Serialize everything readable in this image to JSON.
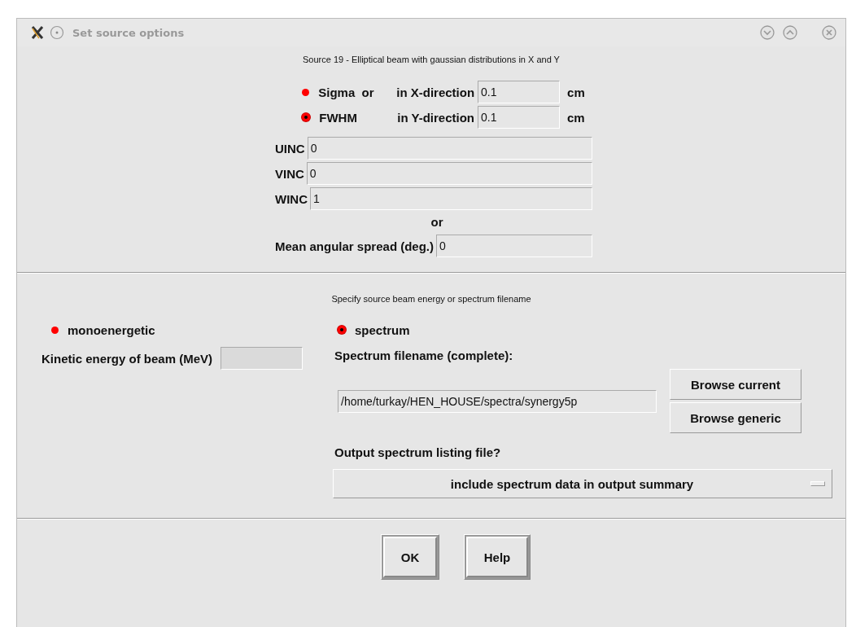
{
  "window": {
    "title": "Set source options"
  },
  "source_title": "Source 19 - Elliptical beam with gaussian distributions in X and Y",
  "width_modes": [
    {
      "label": "Sigma  or",
      "selected": false,
      "direction": "in X-direction",
      "value": "0.1",
      "unit": "cm"
    },
    {
      "label": "FWHM",
      "selected": true,
      "direction": "in Y-direction",
      "value": "0.1",
      "unit": "cm"
    }
  ],
  "direction_fields": [
    {
      "label": "UINC",
      "value": "0"
    },
    {
      "label": "VINC",
      "value": "0"
    },
    {
      "label": "WINC",
      "value": "1"
    }
  ],
  "or_label": "or",
  "angular_spread": {
    "label": "Mean angular spread (deg.)",
    "value": "0"
  },
  "energy_title": "Specify source beam energy or spectrum filename",
  "energy_modes": [
    {
      "label": "monoenergetic",
      "selected": false
    },
    {
      "label": "spectrum",
      "selected": true
    }
  ],
  "kinetic_energy": {
    "label": "Kinetic energy of beam (MeV)"
  },
  "spectrum_file": {
    "label": "Spectrum filename (complete):",
    "value": "/home/turkay/HEN_HOUSE/spectra/synergy5p"
  },
  "browse_buttons": [
    "Browse current",
    "Browse generic"
  ],
  "output_listing": {
    "label": "Output spectrum listing file?",
    "value": "include spectrum data in output summary"
  },
  "buttons": [
    "OK",
    "Help"
  ]
}
